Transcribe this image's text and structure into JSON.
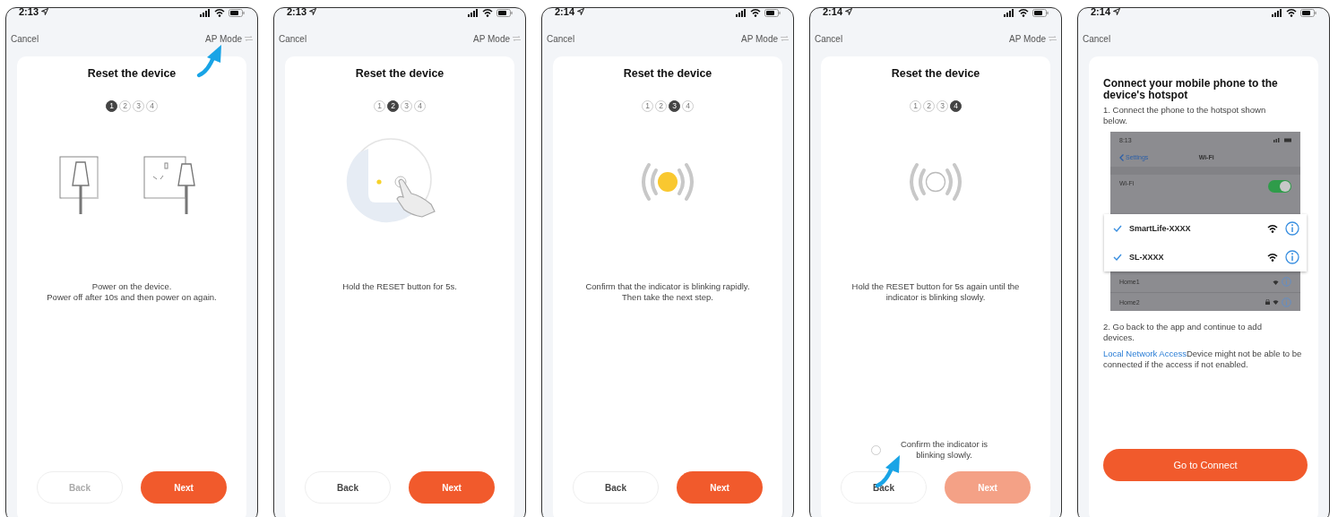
{
  "phones": [
    {
      "kind": "step",
      "time": "2:13",
      "cancel": "Cancel",
      "mode": {
        "label": "AP Mode",
        "pointer_arrow": true
      },
      "title": "Reset the device",
      "steps": [
        {
          "label": "1",
          "selected": true
        },
        {
          "label": "2",
          "selected": false
        },
        {
          "label": "3",
          "selected": false
        },
        {
          "label": "4",
          "selected": false
        }
      ],
      "illustration": {
        "kind": "plug"
      },
      "instruction": "Power on the device.\nPower off after 10s and then power on again.",
      "back": {
        "label": "Back",
        "disabled": true
      },
      "next": {
        "label": "Next",
        "disabled": false
      }
    },
    {
      "kind": "step",
      "time": "2:13",
      "cancel": "Cancel",
      "mode": {
        "label": "AP Mode",
        "pointer_arrow": false
      },
      "title": "Reset the device",
      "steps": [
        {
          "label": "1",
          "selected": false
        },
        {
          "label": "2",
          "selected": true
        },
        {
          "label": "3",
          "selected": false
        },
        {
          "label": "4",
          "selected": false
        }
      ],
      "illustration": {
        "kind": "press"
      },
      "instruction": "Hold the RESET button for 5s.",
      "back": {
        "label": "Back",
        "disabled": false
      },
      "next": {
        "label": "Next",
        "disabled": false
      }
    },
    {
      "kind": "step",
      "time": "2:14",
      "cancel": "Cancel",
      "mode": {
        "label": "AP Mode",
        "pointer_arrow": false
      },
      "title": "Reset the device",
      "steps": [
        {
          "label": "1",
          "selected": false
        },
        {
          "label": "2",
          "selected": false
        },
        {
          "label": "3",
          "selected": true
        },
        {
          "label": "4",
          "selected": false
        }
      ],
      "illustration": {
        "kind": "blink-fast"
      },
      "instruction": "Confirm that the indicator is blinking rapidly.\nThen take the next step.",
      "back": {
        "label": "Back",
        "disabled": false
      },
      "next": {
        "label": "Next",
        "disabled": false
      }
    },
    {
      "kind": "step",
      "time": "2:14",
      "cancel": "Cancel",
      "mode": {
        "label": "AP Mode",
        "pointer_arrow": false
      },
      "title": "Reset the device",
      "steps": [
        {
          "label": "1",
          "selected": false
        },
        {
          "label": "2",
          "selected": false
        },
        {
          "label": "3",
          "selected": false
        },
        {
          "label": "4",
          "selected": true
        }
      ],
      "illustration": {
        "kind": "blink-slow"
      },
      "instruction": "Hold the RESET button for 5s again until the indicator is blinking slowly.",
      "confirm": {
        "label": "Confirm the indicator is blinking slowly.",
        "checked": false,
        "pointer_arrow": true
      },
      "back": {
        "label": "Back",
        "disabled": false
      },
      "next": {
        "label": "Next",
        "disabled": true
      }
    },
    {
      "kind": "hotspot",
      "time": "2:14",
      "cancel": "Cancel",
      "title": "Connect your mobile phone to the device's hotspot",
      "step_1": "1. Connect the phone to the hotspot shown below.",
      "wifi_screenshot": {
        "time": "8:13",
        "back": "Settings",
        "title": "Wi-Fi",
        "wifi_label": "Wi-Fi",
        "wifi_on": true,
        "highlighted": [
          {
            "name": "SmartLife-XXXX",
            "checked": true
          },
          {
            "name": "SL-XXXX",
            "checked": true
          }
        ],
        "others": [
          {
            "name": "Home1",
            "locked": false
          },
          {
            "name": "Home2",
            "locked": true
          }
        ]
      },
      "step_2": "2. Go back to the app and continue to add devices.",
      "note": {
        "link": "Local Network Access",
        "text": "Device might not be able to be connected if the access if not enabled."
      },
      "connect": {
        "label": "Go to Connect"
      }
    }
  ]
}
